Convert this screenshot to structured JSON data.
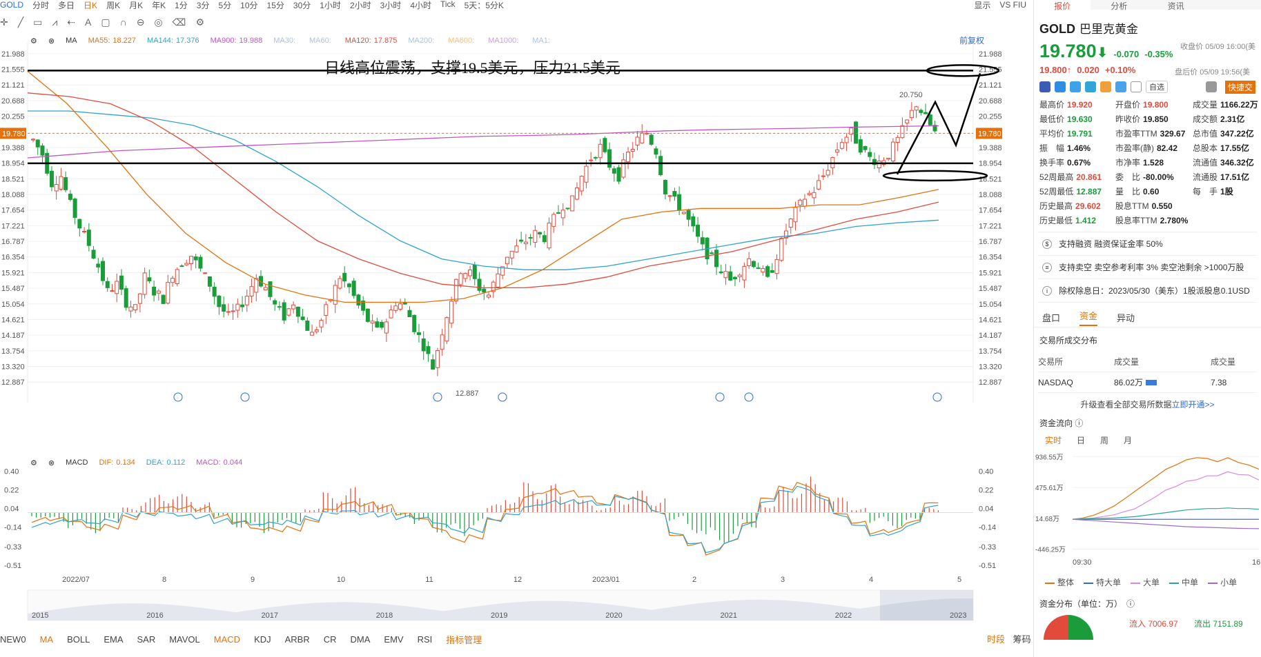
{
  "toolbar": {
    "symbol": "GOLD",
    "periods": [
      "分时",
      "多日",
      "日K",
      "周K",
      "月K",
      "年K",
      "1分",
      "3分",
      "5分",
      "10分",
      "15分",
      "30分",
      "1小时",
      "2小时",
      "3小时",
      "4小时",
      "Tick",
      "5天：5分K"
    ],
    "active_period": "日K",
    "right": [
      "显示",
      "VS FIU"
    ]
  },
  "ma_line": {
    "label": "MA",
    "items": [
      {
        "name": "MA55:",
        "value": "18.227",
        "color": "#e6710b"
      },
      {
        "name": "MA144:",
        "value": "17.376",
        "color": "#2ea4c9"
      },
      {
        "name": "MA900:",
        "value": "19.988",
        "color": "#c154c1"
      },
      {
        "name": "MA30:",
        "value": "",
        "color": "#aac4e6"
      },
      {
        "name": "MA60:",
        "value": "",
        "color": "#aac4e6"
      },
      {
        "name": "MA120:",
        "value": "17.875",
        "color": "#e24a3b"
      },
      {
        "name": "MA200:",
        "value": "",
        "color": "#aac4e6"
      },
      {
        "name": "MA600:",
        "value": "",
        "color": "#f2c27a"
      },
      {
        "name": "MA1000:",
        "value": "",
        "color": "#c9a0e6"
      },
      {
        "name": "MA1:",
        "value": "",
        "color": "#aac4e6"
      }
    ],
    "fuquan": "前复权"
  },
  "macd_line": {
    "label": "MACD",
    "items": [
      {
        "name": "DIF:",
        "value": "0.134",
        "color": "#e6710b"
      },
      {
        "name": "DEA:",
        "value": "0.112",
        "color": "#2ea4c9"
      },
      {
        "name": "MACD:",
        "value": "0.044",
        "color": "#c154c1"
      }
    ]
  },
  "annotation": "日线高位震荡，支撑19.5美元，压力21.5美元",
  "chart_data": [
    {
      "type": "candlestick",
      "title": "",
      "y_ticks": [
        "21.988",
        "21.555",
        "21.121",
        "20.688",
        "20.255",
        "19.780",
        "19.388",
        "18.954",
        "18.521",
        "18.088",
        "17.654",
        "17.221",
        "16.787",
        "16.354",
        "15.921",
        "15.487",
        "15.054",
        "14.621",
        "14.187",
        "13.754",
        "13.320",
        "12.887"
      ],
      "ylim": [
        12.7,
        22.1
      ],
      "last_price": 19.78,
      "x_labels": [
        "2022/07",
        "8",
        "9",
        "10",
        "11",
        "12",
        "2023/01",
        "2",
        "3",
        "4",
        "5"
      ],
      "high_label": "20.750",
      "low_label": "12.887",
      "horizontal_lines": [
        21.52,
        18.95
      ],
      "close_path": [
        19.6,
        19.2,
        18.4,
        18.6,
        17.8,
        17.2,
        16.7,
        16.1,
        15.4,
        15.6,
        15.1,
        14.9,
        15.8,
        15.4,
        15.2,
        15.9,
        16.2,
        16.4,
        16.0,
        15.6,
        15.0,
        14.7,
        14.9,
        15.3,
        15.8,
        15.5,
        15.0,
        14.7,
        15.1,
        14.6,
        14.2,
        14.6,
        15.2,
        15.8,
        15.5,
        15.0,
        14.6,
        14.3,
        14.6,
        15.1,
        15.0,
        14.4,
        13.9,
        13.3,
        14.3,
        15.2,
        16.0,
        15.9,
        15.5,
        15.3,
        15.9,
        16.4,
        16.6,
        16.8,
        17.0,
        16.9,
        17.4,
        17.8,
        17.9,
        18.6,
        19.1,
        19.4,
        18.9,
        18.6,
        19.2,
        19.6,
        19.8,
        19.3,
        18.2,
        17.9,
        17.6,
        17.1,
        16.6,
        16.3,
        16.0,
        15.7,
        16.0,
        16.3,
        16.1,
        15.7,
        16.4,
        17.1,
        17.6,
        18.0,
        18.2,
        18.6,
        19.1,
        19.6,
        19.8,
        19.4,
        19.1,
        19.0,
        19.2,
        19.6,
        20.1,
        20.6,
        20.2,
        19.8
      ],
      "series_end": [
        {
          "name": "MA55",
          "value": 18.227
        },
        {
          "name": "MA144",
          "value": 17.376
        },
        {
          "name": "MA900",
          "value": 19.988
        },
        {
          "name": "MA120",
          "value": 17.875
        }
      ]
    },
    {
      "type": "bar",
      "title": "",
      "y_ticks": [
        "0.40",
        "0.22",
        "0.04",
        "-0.14",
        "-0.33",
        "-0.51"
      ],
      "ylim": [
        -0.55,
        0.45
      ],
      "histogram": [
        -0.05,
        -0.1,
        -0.15,
        -0.2,
        -0.12,
        0.05,
        0.15,
        0.22,
        0.18,
        0.1,
        -0.05,
        -0.15,
        -0.22,
        -0.18,
        -0.1,
        0.05,
        0.2,
        0.25,
        0.18,
        0.08,
        -0.05,
        -0.12,
        -0.2,
        -0.25,
        -0.15,
        0.08,
        0.2,
        0.3,
        0.28,
        0.2,
        0.12,
        0.05,
        0.18,
        0.22,
        0.15,
        -0.08,
        -0.2,
        -0.35,
        -0.3,
        -0.15,
        0.1,
        0.25,
        0.35,
        0.3,
        0.15,
        0.05,
        -0.1,
        -0.15,
        -0.12,
        0.05
      ]
    },
    {
      "type": "area",
      "title": "",
      "x_labels": [
        "2015",
        "2016",
        "2017",
        "2018",
        "2019",
        "2020",
        "2021",
        "2022",
        "2023"
      ]
    },
    {
      "type": "line",
      "title": "",
      "y_ticks": [
        "936.55万",
        "475.61万",
        "14.68万",
        "-446.25万"
      ],
      "x_labels": [
        "09:30",
        "16:"
      ],
      "series": [
        {
          "name": "整体",
          "color": "#e6710b",
          "values": [
            0,
            20,
            60,
            120,
            200,
            300,
            420,
            520,
            640,
            740,
            820,
            880,
            930,
            900,
            870,
            910,
            860,
            800,
            760
          ]
        },
        {
          "name": "特大单",
          "color": "#2f6dd4",
          "values": [
            0,
            0,
            0,
            0,
            0,
            0,
            0,
            0,
            0,
            0,
            0,
            0,
            0,
            0,
            0,
            0,
            0,
            0,
            0
          ]
        },
        {
          "name": "大单",
          "color": "#d98ad9",
          "values": [
            0,
            10,
            20,
            40,
            70,
            110,
            160,
            240,
            340,
            430,
            500,
            560,
            600,
            640,
            660,
            700,
            680,
            650,
            600
          ]
        },
        {
          "name": "中单",
          "color": "#26a69a",
          "values": [
            0,
            5,
            10,
            15,
            20,
            30,
            40,
            60,
            80,
            100,
            120,
            140,
            150,
            160,
            160,
            170,
            160,
            160,
            150
          ]
        },
        {
          "name": "小单",
          "color": "#9c6ad0",
          "values": [
            0,
            -10,
            -20,
            -30,
            -40,
            -50,
            -60,
            -70,
            -80,
            -90,
            -100,
            -110,
            -115,
            -120,
            -125,
            -130,
            -135,
            -138,
            -140
          ]
        }
      ]
    }
  ],
  "bottom_nav": {
    "items": [
      "NEW0",
      "MA",
      "BOLL",
      "EMA",
      "SAR",
      "MAVOL",
      "MACD",
      "KDJ",
      "ARBR",
      "CR",
      "DMA",
      "EMV",
      "RSI"
    ],
    "active": [
      "MA",
      "MACD"
    ],
    "manager": "指标管理",
    "right": [
      "时段",
      "筹码"
    ]
  },
  "panel": {
    "tabs": [
      "报价",
      "分析",
      "资讯",
      ""
    ],
    "symbol": "GOLD",
    "name": "巴里克黄金",
    "price": "19.780",
    "arrow": "⬇",
    "change": "-0.070",
    "change_pct": "-0.35%",
    "close_time": "收盘价 05/09 16:00(美",
    "post_time": "盘后价 05/09 19:56(美",
    "post_price": "19.800↑",
    "post_change": "0.020",
    "post_pct": "+0.10%",
    "watch": "自选",
    "quick": "快捷交",
    "stats": [
      {
        "k": "最高价",
        "v": "19.920",
        "c": "red"
      },
      {
        "k": "开盘价",
        "v": "19.800",
        "c": "red"
      },
      {
        "k": "成交量",
        "v": "1166.22万",
        "c": "blk"
      },
      {
        "k": "最低价",
        "v": "19.630",
        "c": "grn"
      },
      {
        "k": "昨收价",
        "v": "19.850",
        "c": "blk"
      },
      {
        "k": "成交额",
        "v": "2.31亿",
        "c": "blk"
      },
      {
        "k": "平均价",
        "v": "19.791",
        "c": "grn"
      },
      {
        "k": "市盈率TTM",
        "v": "329.67",
        "c": "blk"
      },
      {
        "k": "总市值",
        "v": "347.22亿",
        "c": "blk"
      },
      {
        "k": "振　幅",
        "v": "1.46%",
        "c": "blk"
      },
      {
        "k": "市盈率(静)",
        "v": "82.42",
        "c": "blk"
      },
      {
        "k": "总股本",
        "v": "17.55亿",
        "c": "blk"
      },
      {
        "k": "换手率",
        "v": "0.67%",
        "c": "blk"
      },
      {
        "k": "市净率",
        "v": "1.528",
        "c": "blk"
      },
      {
        "k": "流通值",
        "v": "346.32亿",
        "c": "blk"
      },
      {
        "k": "52周最高",
        "v": "20.861",
        "c": "red"
      },
      {
        "k": "委　比",
        "v": "-80.00%",
        "c": "blk"
      },
      {
        "k": "流通股",
        "v": "17.51亿",
        "c": "blk"
      },
      {
        "k": "52周最低",
        "v": "12.887",
        "c": "grn"
      },
      {
        "k": "量　比",
        "v": "0.60",
        "c": "blk"
      },
      {
        "k": "每　手",
        "v": "1股",
        "c": "blk"
      },
      {
        "k": "历史最高",
        "v": "29.602",
        "c": "red"
      },
      {
        "k": "股息TTM",
        "v": "0.550",
        "c": "blk"
      },
      {
        "k": "",
        "v": "",
        "c": "blk"
      },
      {
        "k": "历史最低",
        "v": "1.412",
        "c": "grn"
      },
      {
        "k": "股息率TTM",
        "v": "2.780%",
        "c": "blk"
      },
      {
        "k": "",
        "v": "",
        "c": "blk"
      }
    ],
    "notices": [
      {
        "icon": "$",
        "text": "支持融资 融资保证金率 50%"
      },
      {
        "icon": "≡",
        "text": "支持卖空 卖空参考利率 3% 卖空池剩余 >1000万股"
      },
      {
        "icon": "i",
        "text": "除权除息日：2023/05/30（美东）1股派股息0.1USD"
      }
    ],
    "subtabs": [
      "盘口",
      "资金",
      "异动"
    ],
    "active_subtab": "资金",
    "exch_title": "交易所成交分布",
    "exch_head": [
      "交易所",
      "成交量",
      "成交量"
    ],
    "exch_row": [
      "NASDAQ",
      "86.02万",
      "7.38"
    ],
    "upgrade_text": "升级查看全部交易所数据",
    "upgrade_link": "立即开通>>",
    "flow_title": "资金流向",
    "flow_tabs": [
      "实时",
      "日",
      "周",
      "月"
    ],
    "dist_title": "资金分布（单位：万）",
    "inflow": "流入 7006.97",
    "outflow": "流出 7151.89"
  }
}
